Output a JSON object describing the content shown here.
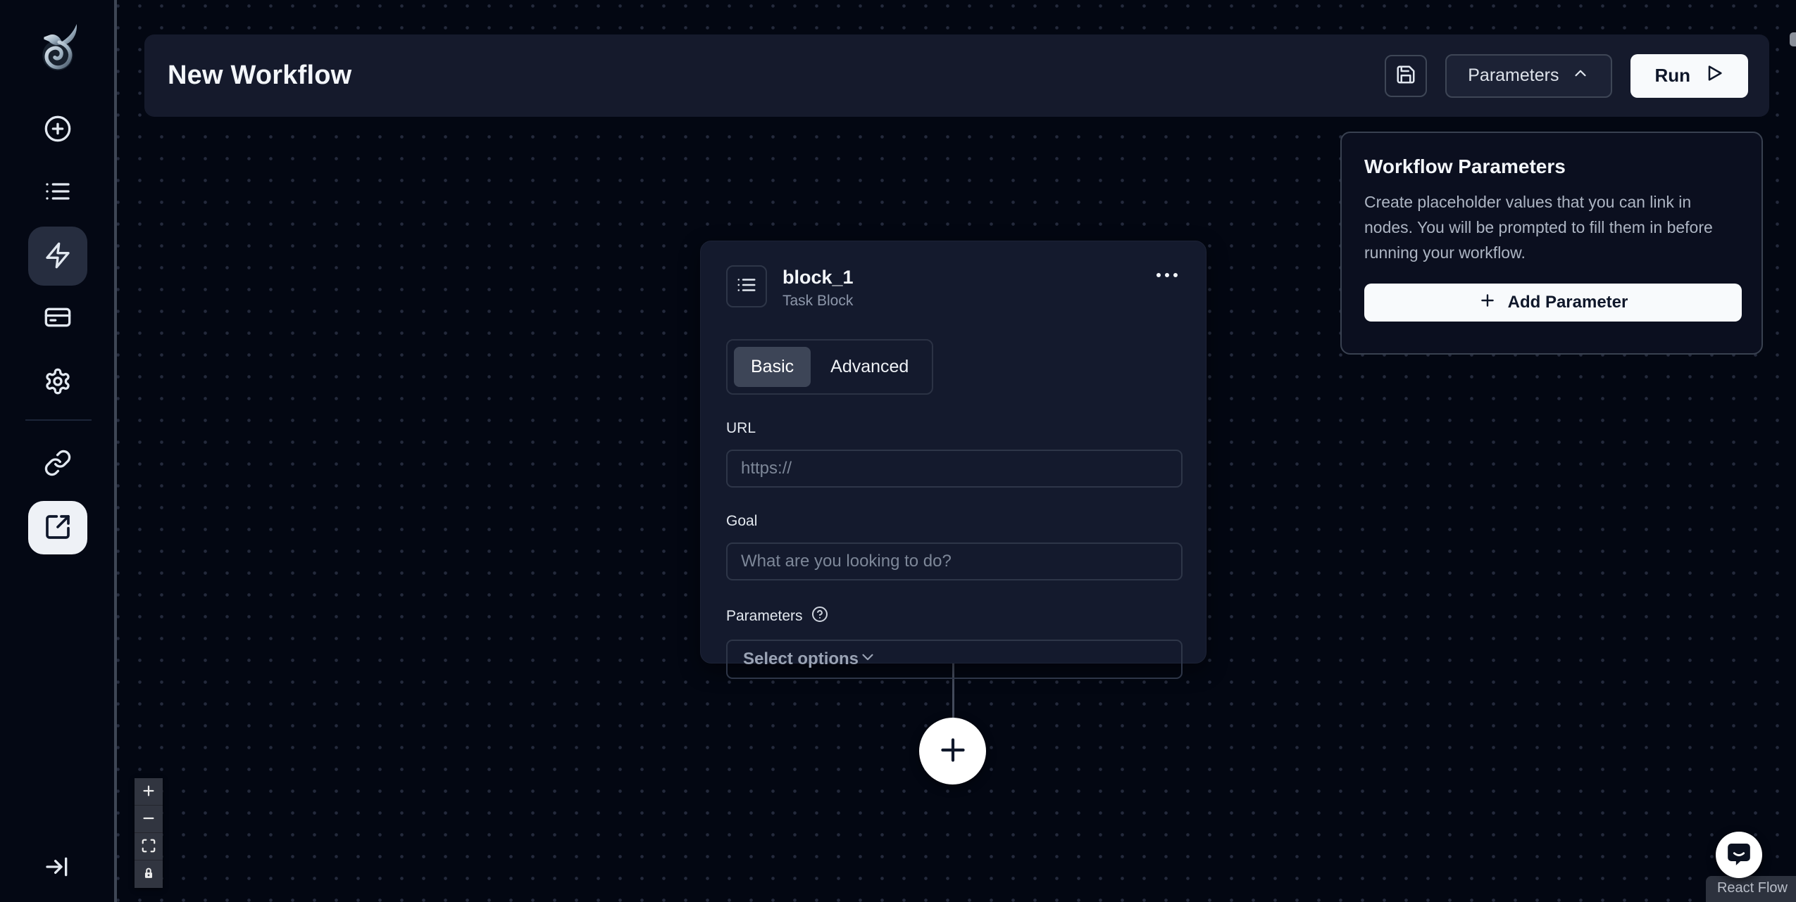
{
  "colors": {
    "canvas_bg": "#030712",
    "panel_bg": "#151a2c",
    "card_bg": "#141a2d",
    "active_tab_bg": "#3d4557",
    "accent_light": "#f8fafc",
    "border": "#2e3648",
    "text_primary": "#f3f6fa",
    "text_muted": "#8d97aa"
  },
  "sidebar": {
    "logo": "dragon-logo",
    "items": [
      {
        "icon": "plus-circle-icon",
        "active": false
      },
      {
        "icon": "list-icon",
        "active": false
      },
      {
        "icon": "zap-icon",
        "active": true
      },
      {
        "icon": "credit-card-icon",
        "active": false
      },
      {
        "icon": "gear-icon",
        "active": false
      },
      {
        "icon": "link-icon",
        "active": false
      },
      {
        "icon": "external-link-icon",
        "active": false,
        "highlighted": true
      }
    ],
    "collapse_icon": "arrow-right-to-line-icon"
  },
  "header": {
    "title": "New Workflow",
    "save_icon": "save-icon",
    "parameters_button": {
      "label": "Parameters",
      "icon": "chevron-up-icon"
    },
    "run_button": {
      "label": "Run",
      "icon": "play-icon"
    }
  },
  "block": {
    "icon": "list-icon",
    "title": "block_1",
    "subtitle": "Task Block",
    "menu_icon": "ellipsis-icon",
    "tabs": [
      {
        "label": "Basic",
        "active": true
      },
      {
        "label": "Advanced",
        "active": false
      }
    ],
    "url": {
      "label": "URL",
      "placeholder": "https://",
      "value": ""
    },
    "goal": {
      "label": "Goal",
      "placeholder": "What are you looking to do?",
      "value": ""
    },
    "parameters": {
      "label": "Parameters",
      "help_icon": "help-circle-icon",
      "select_value": "Select options",
      "select_icon": "chevron-down-icon"
    }
  },
  "connector": {
    "add_node_icon": "plus-icon"
  },
  "workflow_parameters_panel": {
    "title": "Workflow Parameters",
    "description": "Create placeholder values that you can link in nodes. You will be prompted to fill them in before running your workflow.",
    "add_button": {
      "label": "Add Parameter",
      "icon": "plus-icon"
    }
  },
  "flow_controls": {
    "zoom_in_icon": "plus-icon",
    "zoom_out_icon": "minus-icon",
    "fit_view_icon": "maximize-icon",
    "lock_icon": "lock-icon"
  },
  "chat": {
    "icon": "chat-bubble-icon"
  },
  "attribution": {
    "label": "React Flow"
  }
}
